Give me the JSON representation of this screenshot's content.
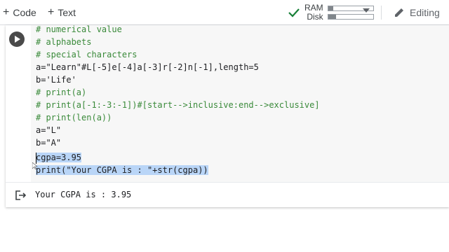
{
  "toolbar": {
    "code_label": "Code",
    "text_label": "Text",
    "ram_label": "RAM",
    "disk_label": "Disk",
    "ram_usage": 0.12,
    "disk_usage": 0.18,
    "editing_label": "Editing"
  },
  "cell": {
    "lines": [
      "# numerical value",
      "# alphabets",
      "# special characters",
      "a=\"Learn\"#L[-5]e[-4]a[-3]r[-2]n[-1],length=5",
      "b='Life'",
      "# print(a)",
      "# print(a[-1:-3:-1])#[start-->inclusive:end-->exclusive]",
      "# print(len(a))",
      "a=\"L\"",
      "b=\"A\"",
      "cgpa=3.95",
      "print(\"Your CGPA is : \"+str(cgpa))"
    ],
    "output": "Your CGPA is : 3.95"
  },
  "colors": {
    "accent_check": "#188038",
    "comment": "#3a8a3a",
    "string": "#a31515",
    "selection": "#b9d5f7"
  }
}
